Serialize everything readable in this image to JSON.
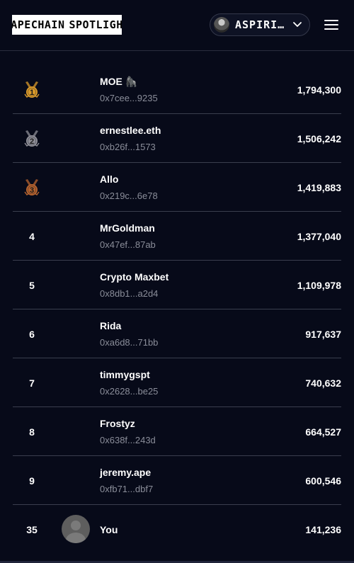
{
  "header": {
    "logo_left": "LAPECHAIN",
    "logo_right": "SPOTLIGHT",
    "user_name": "ASPIRI…"
  },
  "leaderboard": [
    {
      "rank": "1",
      "medal": "gold",
      "name": "MOE 🦍",
      "address": "0x7cee...9235",
      "score": "1,794,300"
    },
    {
      "rank": "2",
      "medal": "silver",
      "name": "ernestlee.eth",
      "address": "0xb26f...1573",
      "score": "1,506,242"
    },
    {
      "rank": "3",
      "medal": "bronze",
      "name": "Allo",
      "address": "0x219c...6e78",
      "score": "1,419,883"
    },
    {
      "rank": "4",
      "name": "MrGoldman",
      "address": "0x47ef...87ab",
      "score": "1,377,040"
    },
    {
      "rank": "5",
      "name": "Crypto Maxbet",
      "address": "0x8db1...a2d4",
      "score": "1,109,978"
    },
    {
      "rank": "6",
      "name": "Rida",
      "address": "0xa6d8...71bb",
      "score": "917,637"
    },
    {
      "rank": "7",
      "name": "timmygspt",
      "address": "0x2628...be25",
      "score": "740,632"
    },
    {
      "rank": "8",
      "name": "Frostyz",
      "address": "0x638f...243d",
      "score": "664,527"
    },
    {
      "rank": "9",
      "name": "jeremy.ape",
      "address": "0xfb71...dbf7",
      "score": "600,546"
    }
  ],
  "you": {
    "rank": "35",
    "name": "You",
    "score": "141,236"
  },
  "colors": {
    "background": "#070a19",
    "gold": "#d99a2b",
    "silver": "#8e8e96",
    "bronze": "#b5632f",
    "muted_text": "#8a8d99"
  },
  "icons": {
    "menu": "hamburger-icon",
    "dropdown": "chevron-down-icon",
    "medal": "medal-icon"
  }
}
